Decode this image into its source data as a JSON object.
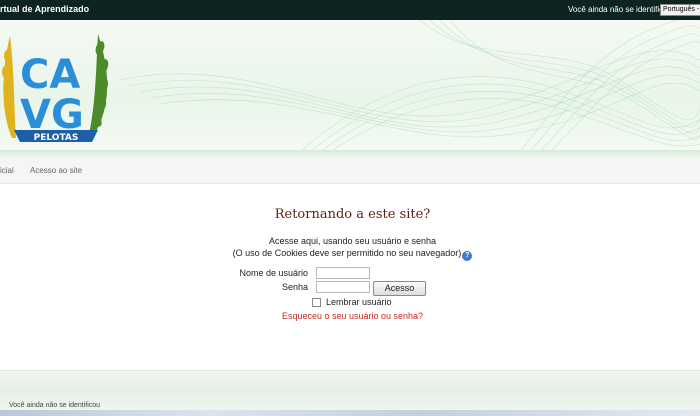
{
  "header": {
    "site_title": "rtual de Aprendizado",
    "login_info": "Você ainda não se identificou",
    "language": "Português - B"
  },
  "logo": {
    "letters_top": "CA",
    "letters_bottom": "VG",
    "ribbon_text": "PELOTAS"
  },
  "nav": {
    "home": "icial",
    "login": "Acesso ao site"
  },
  "login_form": {
    "title": "Retornando a este site?",
    "desc_line1": "Acesse aqui, usando seu usuário e senha",
    "desc_line2": "(O uso de Cookies deve ser permitido no seu navegador)",
    "help_icon": "?",
    "username_label": "Nome de usuário",
    "username_value": "",
    "password_label": "Senha",
    "password_value": "",
    "submit_label": "Acesso",
    "remember_label": "Lembrar usuário",
    "forgot_link": "Esqueceu o seu usuário ou senha?"
  },
  "footer": {
    "login_info": "Você ainda não se identificou"
  },
  "colors": {
    "topbar": "#0d2421",
    "title": "#5a1f13",
    "link": "#c62b23",
    "logo_blue": "#2a8fd8",
    "laurel_green": "#4d8a2a",
    "wheat": "#e0b21e"
  }
}
